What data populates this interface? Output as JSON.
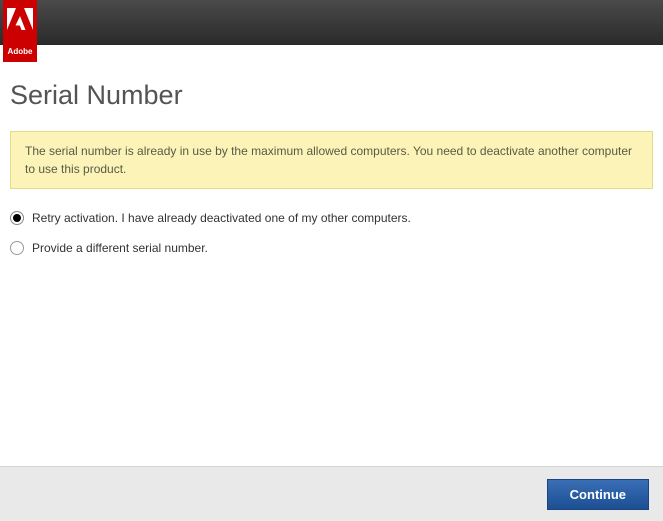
{
  "brand": {
    "name": "Adobe"
  },
  "page": {
    "title": "Serial Number",
    "warning": "The serial number is already in use by the maximum allowed computers. You need to deactivate another computer to use this product."
  },
  "options": {
    "retry": {
      "label": "Retry activation. I have already deactivated one of my other computers.",
      "selected": true
    },
    "provide": {
      "label": "Provide a different serial number.",
      "selected": false
    }
  },
  "footer": {
    "continue_label": "Continue"
  }
}
